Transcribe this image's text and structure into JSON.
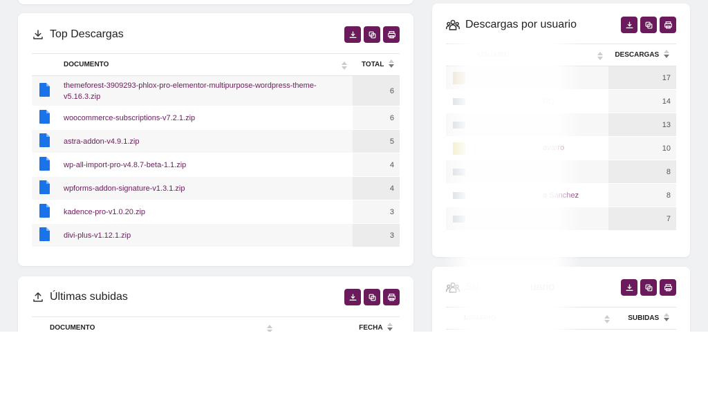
{
  "top_downloads": {
    "title": "Top Descargas",
    "columns": {
      "document": "DOCUMENTO",
      "total": "TOTAL"
    },
    "rows": [
      {
        "name": "themeforest-3909293-phlox-pro-elementor-multipurpose-wordpress-theme-v5.16.3.zip",
        "total": "6"
      },
      {
        "name": "woocommerce-subscriptions-v7.2.1.zip",
        "total": "6"
      },
      {
        "name": "astra-addon-v4.9.1.zip",
        "total": "5"
      },
      {
        "name": "wp-all-import-pro-v4.8.7-beta-1.1.zip",
        "total": "4"
      },
      {
        "name": "wpforms-addon-signature-v1.3.1.zip",
        "total": "4"
      },
      {
        "name": "kadence-pro-v1.0.20.zip",
        "total": "3"
      },
      {
        "name": "divi-plus-v1.12.1.zip",
        "total": "3"
      }
    ]
  },
  "latest_uploads": {
    "title": "Últimas subidas",
    "columns": {
      "document": "DOCUMENTO",
      "date": "FECHA"
    }
  },
  "downloads_by_user": {
    "title": "Descargas por usuario",
    "columns": {
      "user": "USUARIO",
      "downloads": "DESCARGAS"
    },
    "rows": [
      {
        "name": "",
        "count": "17"
      },
      {
        "name": "RO",
        "count": "14"
      },
      {
        "name": "",
        "count": "13"
      },
      {
        "name": "avarro",
        "count": "10"
      },
      {
        "name": "",
        "count": "8"
      },
      {
        "name": "a Sánchez",
        "count": "8"
      },
      {
        "name": "",
        "count": "7"
      }
    ]
  },
  "uploads_by_user": {
    "title_left": "Su",
    "title_right": "uario",
    "columns": {
      "user": "USUARIO",
      "uploads": "SUBIDAS"
    }
  },
  "colors": {
    "accent": "#6b1a5b",
    "file_icon": "#1a73e8"
  }
}
